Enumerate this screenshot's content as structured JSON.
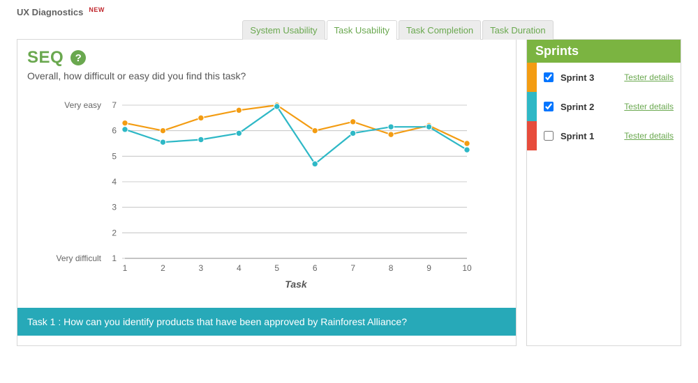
{
  "header": {
    "title": "UX Diagnostics",
    "badge": "NEW"
  },
  "tabs": [
    {
      "label": "System Usability",
      "active": false
    },
    {
      "label": "Task Usability",
      "active": true
    },
    {
      "label": "Task Completion",
      "active": false
    },
    {
      "label": "Task Duration",
      "active": false
    }
  ],
  "seq": {
    "title": "SEQ",
    "help_symbol": "?",
    "subtitle": "Overall, how difficult or easy did you find this task?"
  },
  "chart_data": {
    "type": "line",
    "x": [
      1,
      2,
      3,
      4,
      5,
      6,
      7,
      8,
      9,
      10
    ],
    "series": [
      {
        "name": "Sprint 3",
        "color": "#f39c12",
        "values": [
          6.3,
          6.0,
          6.5,
          6.8,
          7.0,
          6.0,
          6.35,
          5.85,
          6.2,
          5.5
        ]
      },
      {
        "name": "Sprint 2",
        "color": "#2eb8c6",
        "values": [
          6.05,
          5.55,
          5.65,
          5.9,
          6.95,
          4.7,
          5.9,
          6.15,
          6.15,
          5.25
        ]
      }
    ],
    "xlabel": "Task",
    "ylabel_low": "Very difficult",
    "ylabel_high": "Very easy",
    "y_ticks": [
      1,
      2,
      3,
      4,
      5,
      6,
      7
    ],
    "ylim": [
      1,
      7
    ]
  },
  "task_banner": "Task 1 : How can you identify products that have been approved by Rainforest Alliance?",
  "sidebar": {
    "title": "Sprints",
    "link_label": "Tester details",
    "items": [
      {
        "name": "Sprint 3",
        "color": "#f39c12",
        "checked": true
      },
      {
        "name": "Sprint 2",
        "color": "#2eb8c6",
        "checked": true
      },
      {
        "name": "Sprint 1",
        "color": "#e74c3c",
        "checked": false
      }
    ]
  }
}
